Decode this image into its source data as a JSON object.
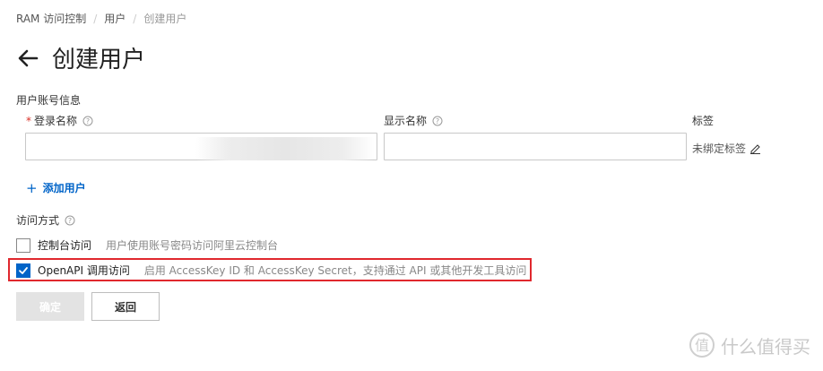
{
  "breadcrumb": {
    "items": [
      "RAM 访问控制",
      "用户",
      "创建用户"
    ],
    "separator": "/"
  },
  "page": {
    "title": "创建用户",
    "back_icon": "arrow-left-icon"
  },
  "account_section": {
    "heading": "用户账号信息",
    "login_name": {
      "required_mark": "*",
      "label": "登录名称",
      "value": "",
      "help_icon": "question-circle-icon"
    },
    "display_name": {
      "label": "显示名称",
      "value": "",
      "help_icon": "question-circle-icon"
    },
    "tags": {
      "label": "标签",
      "value": "未绑定标签",
      "edit_icon": "pencil-icon"
    },
    "add_user": {
      "icon": "plus-icon",
      "plus": "+",
      "label": "添加用户"
    }
  },
  "access_section": {
    "heading": "访问方式",
    "help_icon": "question-circle-icon",
    "options": [
      {
        "label": "控制台访问",
        "description": "用户使用账号密码访问阿里云控制台",
        "checked": false
      },
      {
        "label": "OpenAPI 调用访问",
        "description": "启用 AccessKey ID 和 AccessKey Secret，支持通过 API 或其他开发工具访问",
        "checked": true
      }
    ]
  },
  "actions": {
    "confirm": "确定",
    "back": "返回"
  },
  "watermark": {
    "text": "什么值得买",
    "icon": "smzdm-logo-icon"
  },
  "colors": {
    "primary": "#0064c8",
    "highlight_border": "#e0282e",
    "required": "#d93026"
  }
}
